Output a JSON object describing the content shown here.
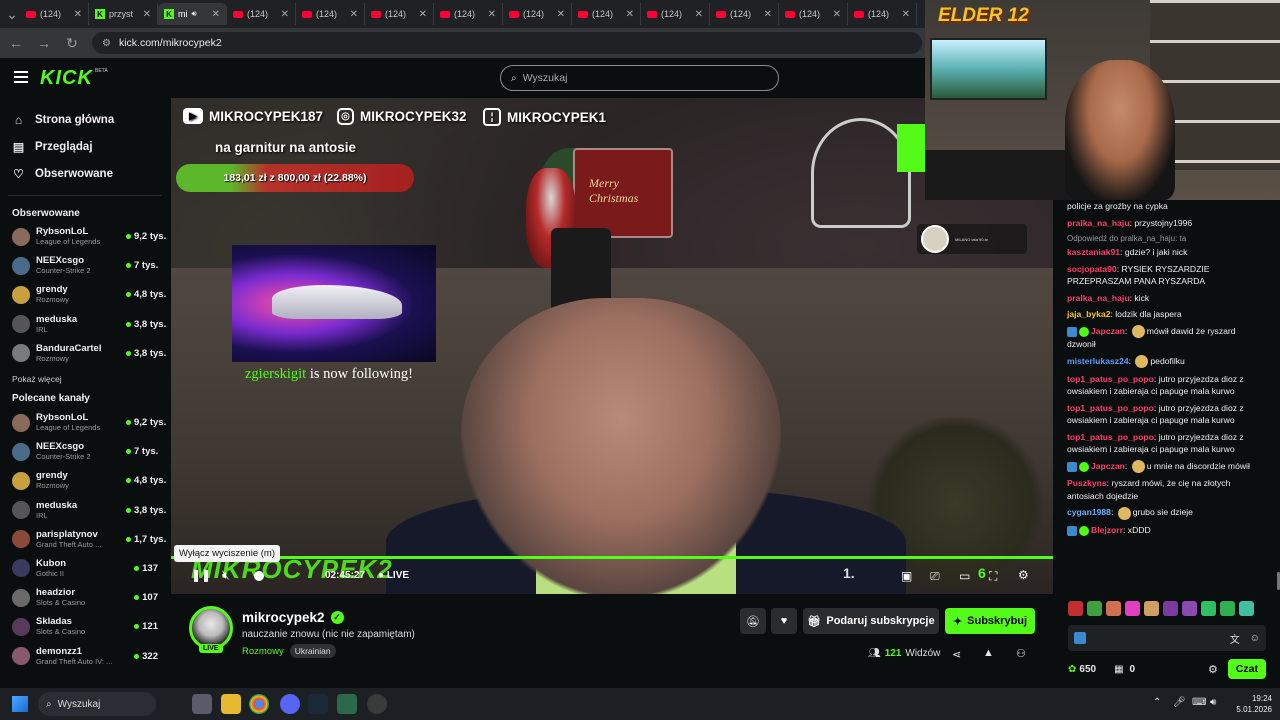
{
  "browser": {
    "tabs": [
      {
        "label": "(124)",
        "type": "youtube"
      },
      {
        "label": "przyst",
        "type": "kick"
      },
      {
        "label": "mi",
        "type": "kick",
        "active": true
      },
      {
        "label": "(124)",
        "type": "youtube"
      },
      {
        "label": "(124)",
        "type": "youtube"
      },
      {
        "label": "(124)",
        "type": "youtube"
      },
      {
        "label": "(124)",
        "type": "youtube"
      },
      {
        "label": "(124)",
        "type": "youtube"
      },
      {
        "label": "(124)",
        "type": "youtube"
      },
      {
        "label": "(124)",
        "type": "youtube"
      },
      {
        "label": "(124)",
        "type": "youtube"
      },
      {
        "label": "(124)",
        "type": "youtube"
      },
      {
        "label": "(124)",
        "type": "youtube"
      }
    ],
    "url": "kick.com/mikrocypek2"
  },
  "header": {
    "logo": "KICK",
    "beta": "BETA",
    "search_placeholder": "Wyszukaj"
  },
  "sidebar": {
    "nav": [
      {
        "label": "Strona główna",
        "icon": "home-icon"
      },
      {
        "label": "Przeglądaj",
        "icon": "browse-icon"
      },
      {
        "label": "Obserwowane",
        "icon": "heart-icon"
      }
    ],
    "followed_title": "Obserwowane",
    "followed": [
      {
        "name": "RybsonLoL",
        "category": "League of Legends",
        "viewers": "9,2 tys.",
        "color": "#8a6a5a"
      },
      {
        "name": "NEEXcsgo",
        "category": "Counter-Strike 2",
        "viewers": "7 tys.",
        "color": "#4a6a8a"
      },
      {
        "name": "grendy",
        "category": "Rozmowy",
        "viewers": "4,8 tys.",
        "color": "#c8a040"
      },
      {
        "name": "meduska",
        "category": "IRL",
        "viewers": "3,8 tys.",
        "color": "#555555"
      },
      {
        "name": "BanduraCartel",
        "category": "Rozmowy",
        "viewers": "3,8 tys.",
        "color": "#7a7a7a"
      }
    ],
    "show_more": "Pokaż więcej",
    "recommended_title": "Polecane kanały",
    "recommended": [
      {
        "name": "RybsonLoL",
        "category": "League of Legends",
        "viewers": "9,2 tys.",
        "color": "#8a6a5a"
      },
      {
        "name": "NEEXcsgo",
        "category": "Counter-Strike 2",
        "viewers": "7 tys.",
        "color": "#4a6a8a"
      },
      {
        "name": "grendy",
        "category": "Rozmowy",
        "viewers": "4,8 tys.",
        "color": "#c8a040"
      },
      {
        "name": "meduska",
        "category": "IRL",
        "viewers": "3,8 tys.",
        "color": "#555555"
      },
      {
        "name": "parisplatynov",
        "category": "Grand Theft Auto ...",
        "viewers": "1,7 tys.",
        "color": "#8a4a3a"
      },
      {
        "name": "Kubon",
        "category": "Gothic II",
        "viewers": "137",
        "color": "#3a3a5a"
      },
      {
        "name": "headzior",
        "category": "Slots & Casino",
        "viewers": "107",
        "color": "#6a6a6a"
      },
      {
        "name": "Skladas",
        "category": "Slots & Casino",
        "viewers": "121",
        "color": "#5a3a5a"
      },
      {
        "name": "demonzz1",
        "category": "Grand Theft Auto IV: ...",
        "viewers": "322",
        "color": "#8a5a6a"
      }
    ]
  },
  "video": {
    "socials": [
      {
        "name": "MIKROCYPEK187",
        "icon": "youtube-icon"
      },
      {
        "name": "MIKROCYPEK32",
        "icon": "instagram-icon"
      },
      {
        "name": "MIKROCYPEK1",
        "icon": "twitch-icon"
      }
    ],
    "goal_title": "na garnitur na antosie",
    "goal_text": "183,01 zł z 800,00 zł (22.88%)",
    "goal_fraction": 0.2288,
    "merry": "Merry Christmas",
    "follower_name": "zgierskigit",
    "follow_text": "is now following!",
    "marquee": "MIKROCYPEK2",
    "tooltip": "Wyłącz wyciszenie (m)",
    "time": "02:45:27",
    "live": "LIVE",
    "mini_text": "MILANO lata 90-te",
    "ticker_left": "1.",
    "ticker_right": "6"
  },
  "facecam": {
    "logo": "ELDER 12"
  },
  "chat": {
    "messages": [
      {
        "user": "",
        "text": "policje za groźby na cypka",
        "color": "#eeeeee"
      },
      {
        "user": "pralka_na_haju",
        "text": "przystojny1996",
        "color": "#ff3d6a"
      },
      {
        "reply": "Odpowiedź do pralka_na_haju: ta",
        "user": "kasztaniak91",
        "text": "gdzie? i jaki nick",
        "color": "#ff3d6a"
      },
      {
        "user": "socjopata90",
        "text": "RYSIEK RYSZARDZIE PRZEPRASZAM PANA RYSZARDA",
        "color": "#ff3d6a"
      },
      {
        "user": "pralka_na_haju",
        "text": "kick",
        "color": "#ff3d6a"
      },
      {
        "user": "jaja_byka2",
        "text": "lodzik dla jaspera",
        "color": "#f3c623"
      },
      {
        "user": "Japczan",
        "text": "mówił dawid że ryszard dzwonił",
        "color": "#ff3d6a",
        "badges": true,
        "emote": true
      },
      {
        "user": "misterlukasz24",
        "text": "pedofilku",
        "color": "#5a9aff",
        "emote": true
      },
      {
        "user": "top1_patus_po_popo",
        "text": "jutro przyjezdza dioz z owsiakiem i zabieraja ci papuge mala kurwo",
        "color": "#ff3d6a"
      },
      {
        "user": "top1_patus_po_popo",
        "text": "jutro przyjezdza dioz z owsiakiem i zabieraja ci papuge mala kurwo",
        "color": "#ff3d6a"
      },
      {
        "user": "top1_patus_po_popo",
        "text": "jutro przyjezdza dioz z owsiakiem i zabieraja ci papuge mala kurwo",
        "color": "#ff3d6a"
      },
      {
        "user": "Japczan",
        "text": "u mnie na discordzie mówił",
        "color": "#ff3d6a",
        "badges": true,
        "emote": true
      },
      {
        "user": "Puszkyns",
        "text": "ryszard mówi, że cię na złotych antosiach dojedzie",
        "color": "#ff3d6a"
      },
      {
        "user": "cygan1988",
        "text": "grubo sie dzieje",
        "color": "#6ab0ff",
        "emote": true
      },
      {
        "user": "Blejzorr",
        "text": "xDDD",
        "color": "#ff3d6a",
        "badges": true
      }
    ],
    "points": "650",
    "gifts": "0",
    "send_label": "Czat"
  },
  "channel": {
    "name": "mikrocypek2",
    "title": "nauczanie znowu (nic nie zapamiętam)",
    "category": "Rozmowy",
    "tag": "Ukrainian",
    "live": "LIVE",
    "gift_label": "Podaruj subskrypcje",
    "subscribe_label": "Subskrybuj",
    "viewers": "121",
    "viewers_label": "Widzów"
  },
  "taskbar": {
    "search": "Wyszukaj",
    "time": "19:24",
    "date": "5.01.2026"
  },
  "colors": {
    "accent": "#53fc18",
    "bg": "#0b0e0f"
  }
}
